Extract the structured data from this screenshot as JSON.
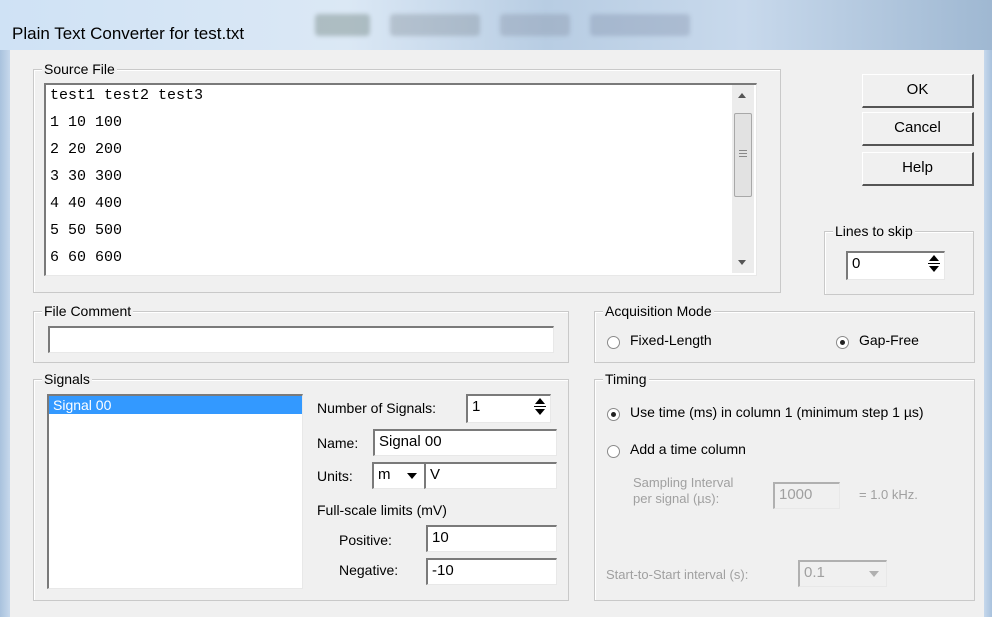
{
  "window": {
    "title": "Plain Text Converter for test.txt"
  },
  "buttons": {
    "ok": "OK",
    "cancel": "Cancel",
    "help": "Help"
  },
  "source_file": {
    "legend": "Source File",
    "lines": [
      "test1 test2 test3",
      "1 10 100",
      "2 20 200",
      "3 30 300",
      "4 40 400",
      "5 50 500",
      "6 60 600"
    ]
  },
  "lines_to_skip": {
    "legend": "Lines to skip",
    "value": "0"
  },
  "file_comment": {
    "legend": "File Comment",
    "value": ""
  },
  "acquisition_mode": {
    "legend": "Acquisition Mode",
    "fixed_length": "Fixed-Length",
    "gap_free": "Gap-Free",
    "selected": "gap_free"
  },
  "signals": {
    "legend": "Signals",
    "list": [
      "Signal 00"
    ],
    "selected_index": 0,
    "number_label": "Number of Signals:",
    "number_value": "1",
    "name_label": "Name:",
    "name_value": "Signal 00",
    "units_label": "Units:",
    "units_prefix": "m",
    "units_value": "V",
    "fullscale_label": "Full-scale limits (mV)",
    "positive_label": "Positive:",
    "positive_value": "10",
    "negative_label": "Negative:",
    "negative_value": "-10"
  },
  "timing": {
    "legend": "Timing",
    "use_time_label": "Use time (ms) in column 1 (minimum step 1 µs)",
    "add_time_label": "Add a time column",
    "selected": "use_time",
    "sampling_line1": "Sampling Interval",
    "sampling_line2": "per signal (µs):",
    "sampling_value": "1000",
    "sampling_freq": "= 1.0 kHz.",
    "start_to_start_label": "Start-to-Start interval (s):",
    "start_to_start_value": "0.1"
  },
  "colors": {
    "selection": "#3399ff",
    "disabled_text": "#a0a0a0"
  }
}
